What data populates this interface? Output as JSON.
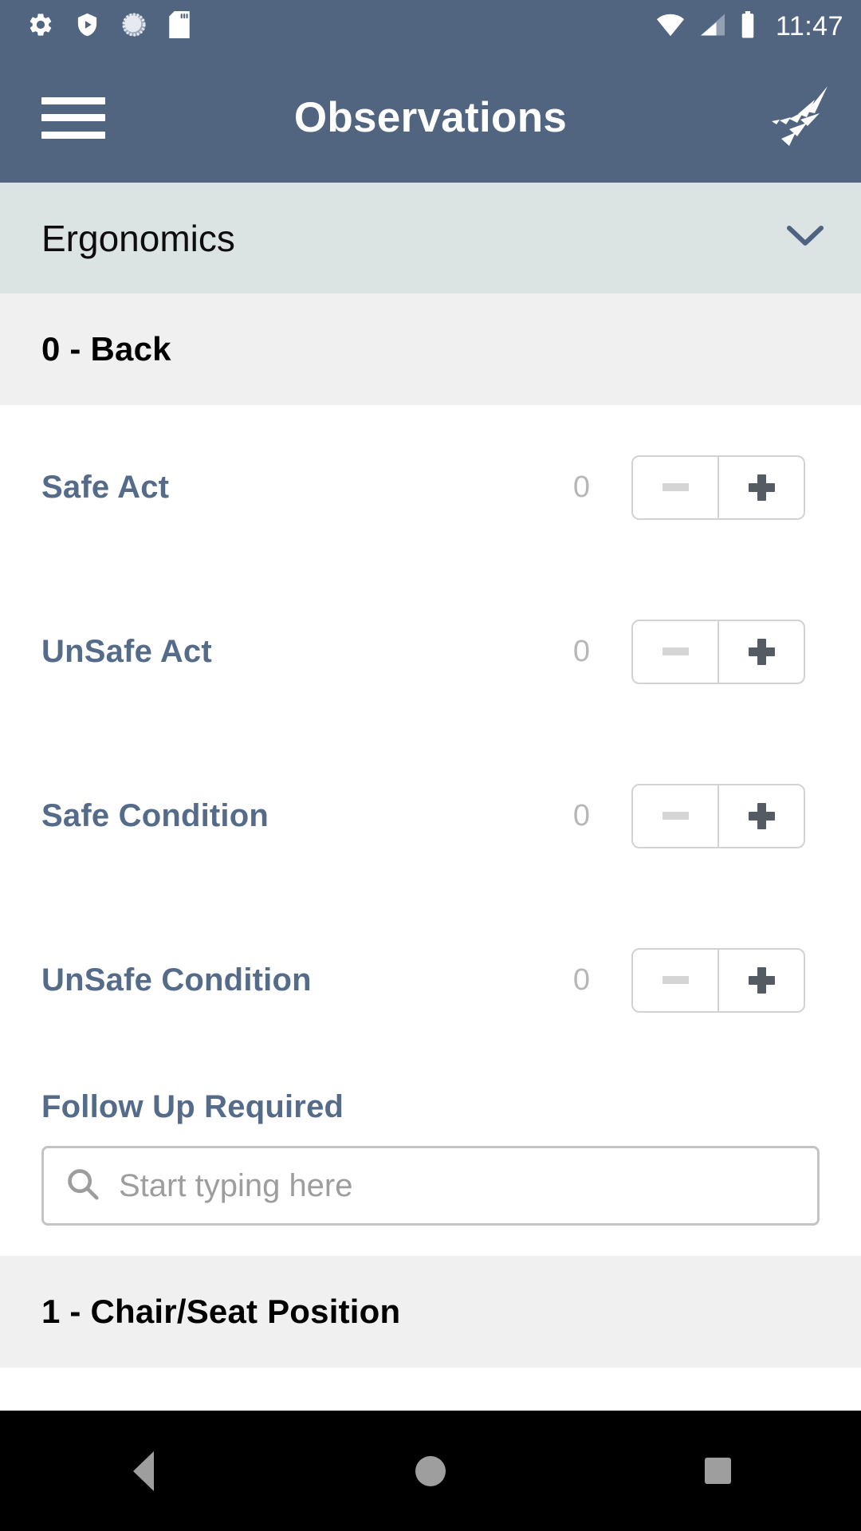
{
  "status_bar": {
    "time": "11:47",
    "notification_icons": [
      "settings-gear-icon",
      "play-protect-shield-icon",
      "sync-progress-icon",
      "sd-card-icon"
    ],
    "system_icons": [
      "wifi-icon",
      "cellular-signal-icon",
      "battery-icon"
    ]
  },
  "app_bar": {
    "menu_icon": "hamburger-menu-icon",
    "title": "Observations",
    "logo_icon": "app-brand-logo-icon"
  },
  "category_selector": {
    "label": "Ergonomics",
    "caret_icon": "chevron-down-icon"
  },
  "sections": [
    {
      "title": "0 - Back",
      "counters": [
        {
          "label": "Safe Act",
          "value": "0",
          "decrement_label": "minus-icon",
          "increment_label": "plus-icon"
        },
        {
          "label": "UnSafe Act",
          "value": "0",
          "decrement_label": "minus-icon",
          "increment_label": "plus-icon"
        },
        {
          "label": "Safe Condition",
          "value": "0",
          "decrement_label": "minus-icon",
          "increment_label": "plus-icon"
        },
        {
          "label": "UnSafe Condition",
          "value": "0",
          "decrement_label": "minus-icon",
          "increment_label": "plus-icon"
        }
      ],
      "follow_up": {
        "label": "Follow Up Required",
        "placeholder": "Start typing here",
        "value": "",
        "search_icon": "search-icon"
      }
    },
    {
      "title": "1 - Chair/Seat Position"
    }
  ],
  "nav_bar": {
    "back_icon": "android-back-icon",
    "home_icon": "android-home-icon",
    "recents_icon": "android-recents-icon"
  },
  "colors": {
    "header_blue": "#516480",
    "band_gray": "#dce3e3",
    "section_gray": "#f0f0f0",
    "label_blue": "#546b8a",
    "value_gray": "#b7b7b7",
    "plus_gray": "#555b62",
    "minus_gray": "#d5d5d5"
  }
}
